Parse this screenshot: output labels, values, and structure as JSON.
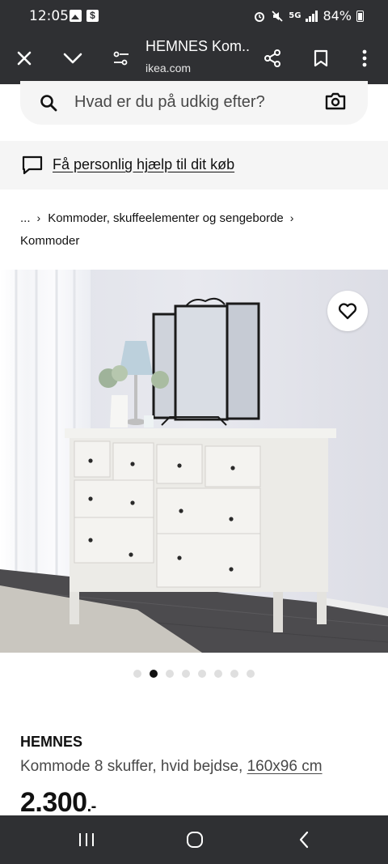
{
  "status": {
    "time": "12:05",
    "battery": "84%",
    "network": "5G"
  },
  "browser": {
    "title": "HEMNES Kom...",
    "url": "ikea.com"
  },
  "search": {
    "placeholder": "Hvad er du på udkig efter?"
  },
  "help": {
    "label": "Få personlig hjælp til dit køb"
  },
  "breadcrumb": {
    "items": [
      "...",
      "Kommoder, skuffeelementer og sengeborde",
      "Kommoder"
    ]
  },
  "gallery": {
    "image_count": 8,
    "active_index": 1
  },
  "product": {
    "name": "HEMNES",
    "description": "Kommode 8 skuffer, hvid bejdse, ",
    "dimensions": "160x96 cm",
    "price": "2.300",
    "price_suffix": ".-"
  },
  "icons": {
    "close": "close-icon",
    "chevron": "chevron-down-icon",
    "tune": "tune-icon",
    "share": "share-icon",
    "bookmark": "bookmark-icon",
    "more": "more-vert-icon",
    "search": "search-icon",
    "camera": "camera-icon",
    "chat": "chat-icon",
    "heart": "heart-icon"
  },
  "colors": {
    "system_bar": "#2f3033",
    "surface": "#f5f5f5",
    "text": "#111111"
  }
}
